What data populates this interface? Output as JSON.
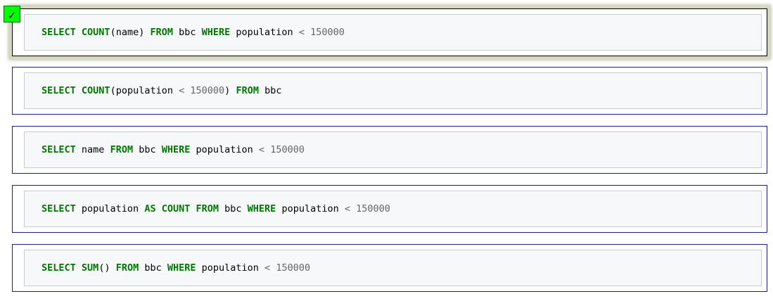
{
  "selection": {
    "selected_index": 0,
    "check_mark": "✓",
    "highlight_color": "#00ff00"
  },
  "options": [
    {
      "tokens": [
        {
          "t": "SELECT",
          "k": "kw"
        },
        {
          "t": " "
        },
        {
          "t": "COUNT",
          "k": "fn"
        },
        {
          "t": "(name) "
        },
        {
          "t": "FROM",
          "k": "kw"
        },
        {
          "t": " bbc "
        },
        {
          "t": "WHERE",
          "k": "kw"
        },
        {
          "t": " population "
        },
        {
          "t": "<",
          "k": "op"
        },
        {
          "t": " "
        },
        {
          "t": "150000",
          "k": "num"
        }
      ]
    },
    {
      "tokens": [
        {
          "t": "SELECT",
          "k": "kw"
        },
        {
          "t": " "
        },
        {
          "t": "COUNT",
          "k": "fn"
        },
        {
          "t": "(population "
        },
        {
          "t": "<",
          "k": "op"
        },
        {
          "t": " "
        },
        {
          "t": "150000",
          "k": "num"
        },
        {
          "t": ") "
        },
        {
          "t": "FROM",
          "k": "kw"
        },
        {
          "t": " bbc"
        }
      ]
    },
    {
      "tokens": [
        {
          "t": "SELECT",
          "k": "kw"
        },
        {
          "t": " name "
        },
        {
          "t": "FROM",
          "k": "kw"
        },
        {
          "t": " bbc "
        },
        {
          "t": "WHERE",
          "k": "kw"
        },
        {
          "t": " population "
        },
        {
          "t": "<",
          "k": "op"
        },
        {
          "t": " "
        },
        {
          "t": "150000",
          "k": "num"
        }
      ]
    },
    {
      "tokens": [
        {
          "t": "SELECT",
          "k": "kw"
        },
        {
          "t": " population "
        },
        {
          "t": "AS",
          "k": "kw"
        },
        {
          "t": " "
        },
        {
          "t": "COUNT",
          "k": "kw"
        },
        {
          "t": " "
        },
        {
          "t": "FROM",
          "k": "kw"
        },
        {
          "t": " bbc "
        },
        {
          "t": "WHERE",
          "k": "kw"
        },
        {
          "t": " population "
        },
        {
          "t": "<",
          "k": "op"
        },
        {
          "t": " "
        },
        {
          "t": "150000",
          "k": "num"
        }
      ]
    },
    {
      "tokens": [
        {
          "t": "SELECT",
          "k": "kw"
        },
        {
          "t": " "
        },
        {
          "t": "SUM",
          "k": "fn"
        },
        {
          "t": "() "
        },
        {
          "t": "FROM",
          "k": "kw"
        },
        {
          "t": " bbc "
        },
        {
          "t": "WHERE",
          "k": "kw"
        },
        {
          "t": " population "
        },
        {
          "t": "<",
          "k": "op"
        },
        {
          "t": " "
        },
        {
          "t": "150000",
          "k": "num"
        }
      ]
    }
  ]
}
